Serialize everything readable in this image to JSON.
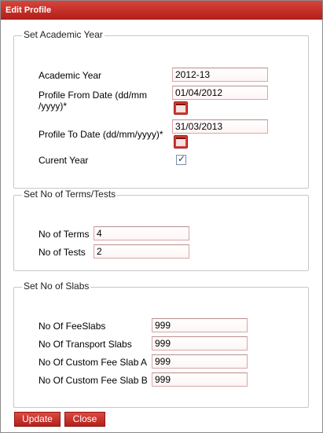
{
  "window": {
    "title": "Edit Profile"
  },
  "academic": {
    "legend": "Set Academic Year",
    "year_label": "Academic Year",
    "year_value": "2012-13",
    "from_label_line1": "Profile From Date (dd/mm",
    "from_label_line2": "/yyyy)*",
    "from_value": "01/04/2012",
    "to_label": "Profile To Date (dd/mm/yyyy)*",
    "to_value": "31/03/2013",
    "current_label": "Curent Year",
    "current_checked": true,
    "calendar_icon": "calendar-icon",
    "checkmark_glyph": "✓"
  },
  "terms": {
    "legend": "Set No of Terms/Tests",
    "terms_label": "No of Terms",
    "terms_value": "4",
    "tests_label": "No of Tests",
    "tests_value": "2"
  },
  "slabs": {
    "legend": "Set No of Slabs",
    "fee_label": "No Of FeeSlabs",
    "fee_value": "999",
    "transport_label": "No Of Transport Slabs",
    "transport_value": "999",
    "custom_a_label": "No Of Custom Fee Slab A",
    "custom_a_value": "999",
    "custom_b_label": "No Of Custom Fee Slab B",
    "custom_b_value": "999"
  },
  "buttons": {
    "update": "Update",
    "close": "Close"
  },
  "colors": {
    "accent": "#c0281f",
    "input_border": "#d6a7a7"
  }
}
